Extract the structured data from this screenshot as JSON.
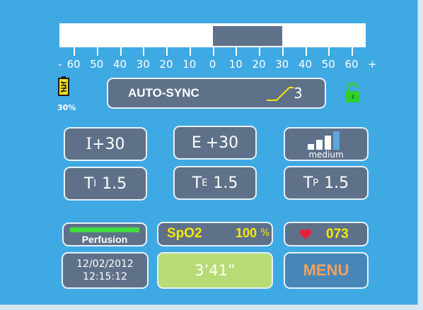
{
  "scale": {
    "labels": [
      "60",
      "50",
      "40",
      "30",
      "20",
      "10",
      "0",
      "10",
      "20",
      "30",
      "40",
      "50",
      "60"
    ],
    "minus": "-",
    "plus": "+",
    "range_min": -60,
    "range_max": 60,
    "indicator_from": 0,
    "indicator_to": 30
  },
  "battery": {
    "icon": "battery-icon",
    "percent": "30%",
    "level": 0.3
  },
  "lock": {
    "icon": "unlocked-padlock-icon",
    "color": "#2fd02f"
  },
  "auto_sync": {
    "label": "AUTO-SYNC",
    "value": "3",
    "icon": "ramp-curve-icon"
  },
  "params": {
    "i": {
      "prefix": "I",
      "value": "+30"
    },
    "e": {
      "prefix": "E",
      "value": "+30"
    },
    "trigger": {
      "label": "medium",
      "icon": "signal-bars-icon",
      "level_filled": 3,
      "level_total": 4
    },
    "ti": {
      "main": "T",
      "sub": "I",
      "value": "1.5"
    },
    "te": {
      "main": "T",
      "sub": "E",
      "value": "1.5"
    },
    "tp": {
      "main": "T",
      "sub": "P",
      "value": "1.5"
    }
  },
  "perfusion": {
    "label": "Perfusion",
    "bar_color": "#3fdb3f"
  },
  "spo2": {
    "label": "SpO2",
    "value": "100",
    "unit": "%"
  },
  "heart": {
    "value": "073",
    "icon": "heart-icon"
  },
  "datetime": {
    "date": "12/02/2012",
    "time": "12:15:12"
  },
  "timer": {
    "value": "3’41”"
  },
  "menu": {
    "label": "MENU"
  },
  "colors": {
    "background": "#3fa9e3",
    "panel": "#5f7189",
    "accent_yellow": "#f6e80c",
    "menu_text": "#f2a15e",
    "timer_bg": "#b8dc75"
  }
}
